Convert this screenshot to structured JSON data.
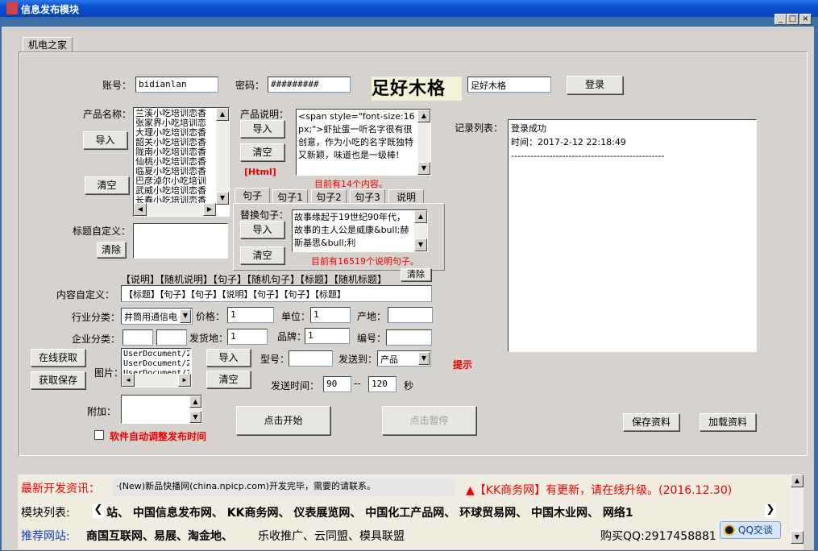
{
  "window": {
    "title": "信息发布模块",
    "min": "_",
    "max": "□",
    "close": "×"
  },
  "tab": "机电之家",
  "login": {
    "account_label": "账号：",
    "account_value": "bidianlan",
    "password_label": "密码：",
    "password_value": "#########",
    "captcha_text": "足好木格",
    "captcha_value": "足好木格",
    "login_button": "登录"
  },
  "product": {
    "label": "产品名称：",
    "import": "导入",
    "clear": "清空",
    "items": [
      "兰溪小吃培训恋香",
      "张家界小吃培训恋",
      "大理小吃培训恋香",
      "韶关小吃培训恋香",
      "陇南小吃培训恋香",
      "仙桃小吃培训恋香",
      "临夏小吃培训恋香",
      "巴彦淖尔小吃培训",
      "武威小吃培训恋香",
      "长春小吃培训恋香"
    ]
  },
  "desc": {
    "label": "产品说明：",
    "import": "导入",
    "clear": "清空",
    "html_label": "[Html]",
    "text": "<span style=\"font-size:16px;\">虾扯蛋一听名字很有很创意，作为小吃的名字既独特又新颖，味道也是一级棒!",
    "count": "目前有14个内容。"
  },
  "sentence_tabs": [
    "句子",
    "句子1",
    "句子2",
    "句子3",
    "说明"
  ],
  "replace": {
    "label": "替换句子：",
    "import": "导入",
    "clear": "清空",
    "text": "故事缘起于19世纪90年代，故事的主人公是威康&bull;赫斯基思&bull;利",
    "count": "目前有16519个说明句子。"
  },
  "title_custom": {
    "label": "标题自定义：",
    "clear": "清除"
  },
  "macros": {
    "text": "【说明】【随机说明】【句子】【随机句子】【标题】【随机标题】",
    "clear": "清除"
  },
  "content_custom": {
    "label": "内容自定义：",
    "value": "【标题】【句子】【句子】【说明】【句子】【句子】【标题】"
  },
  "industry": {
    "label": "行业分类：",
    "value": "井筒用通信电",
    "price_label": "价格：",
    "price": "1",
    "unit_label": "单位：",
    "unit": "1",
    "origin_label": "产地：",
    "origin": ""
  },
  "company": {
    "label": "企业分类：",
    "ship_label": "发货地：",
    "ship": "1",
    "brand_label": "品牌：",
    "brand": "1",
    "code_label": "编号：",
    "code": ""
  },
  "images": {
    "online_button": "在线获取",
    "save_button": "获取保存",
    "label": "图片：",
    "items": [
      "UserDocument/2",
      "UserDocument/2",
      "UserDocument/2"
    ],
    "import": "导入",
    "clear": "清空",
    "model_label": "型号：",
    "sendto_label": "发送到：",
    "sendto_value": "产品",
    "hint": "提示"
  },
  "send_time": {
    "label": "发送时间：",
    "from": "90",
    "sep": "--",
    "to": "120",
    "unit": "秒"
  },
  "extra": {
    "label": "附加：",
    "auto_label": "软件自动调整发布时间",
    "start": "点击开始",
    "pause": "点击暂停",
    "save": "保存资料",
    "load": "加载资料"
  },
  "log": {
    "label": "记录列表：",
    "lines": [
      "登录成功",
      "时间：2017-2-12 22:18:49",
      "------------------------------------------------"
    ]
  },
  "bottom": {
    "news_label": "最新开发资讯：",
    "news_text": "·(New)新品快播网(china.npicp.com)开发完毕，需要的请联系。",
    "update_text": "▲【KK商务网】有更新，请在线升级。(2016.12.30)",
    "modules_label": "模块列表:",
    "modules": "站、  中国信息发布网、  KK商务网、  仪表展览网、  中国化工产品网、  环球贸易网、  中国木业网、  网络1",
    "rec_label": "推荐网站:",
    "rec_bold": "商国互联网、易展、淘金地、",
    "rec_plain": "乐收推广、云同盟、模具联盟",
    "qq": "购买QQ:2917458881",
    "qq_button": "QQ交谈"
  },
  "colors": {
    "title": "#0a4fd0",
    "red": "#e00000",
    "blue": "#1040c0"
  }
}
